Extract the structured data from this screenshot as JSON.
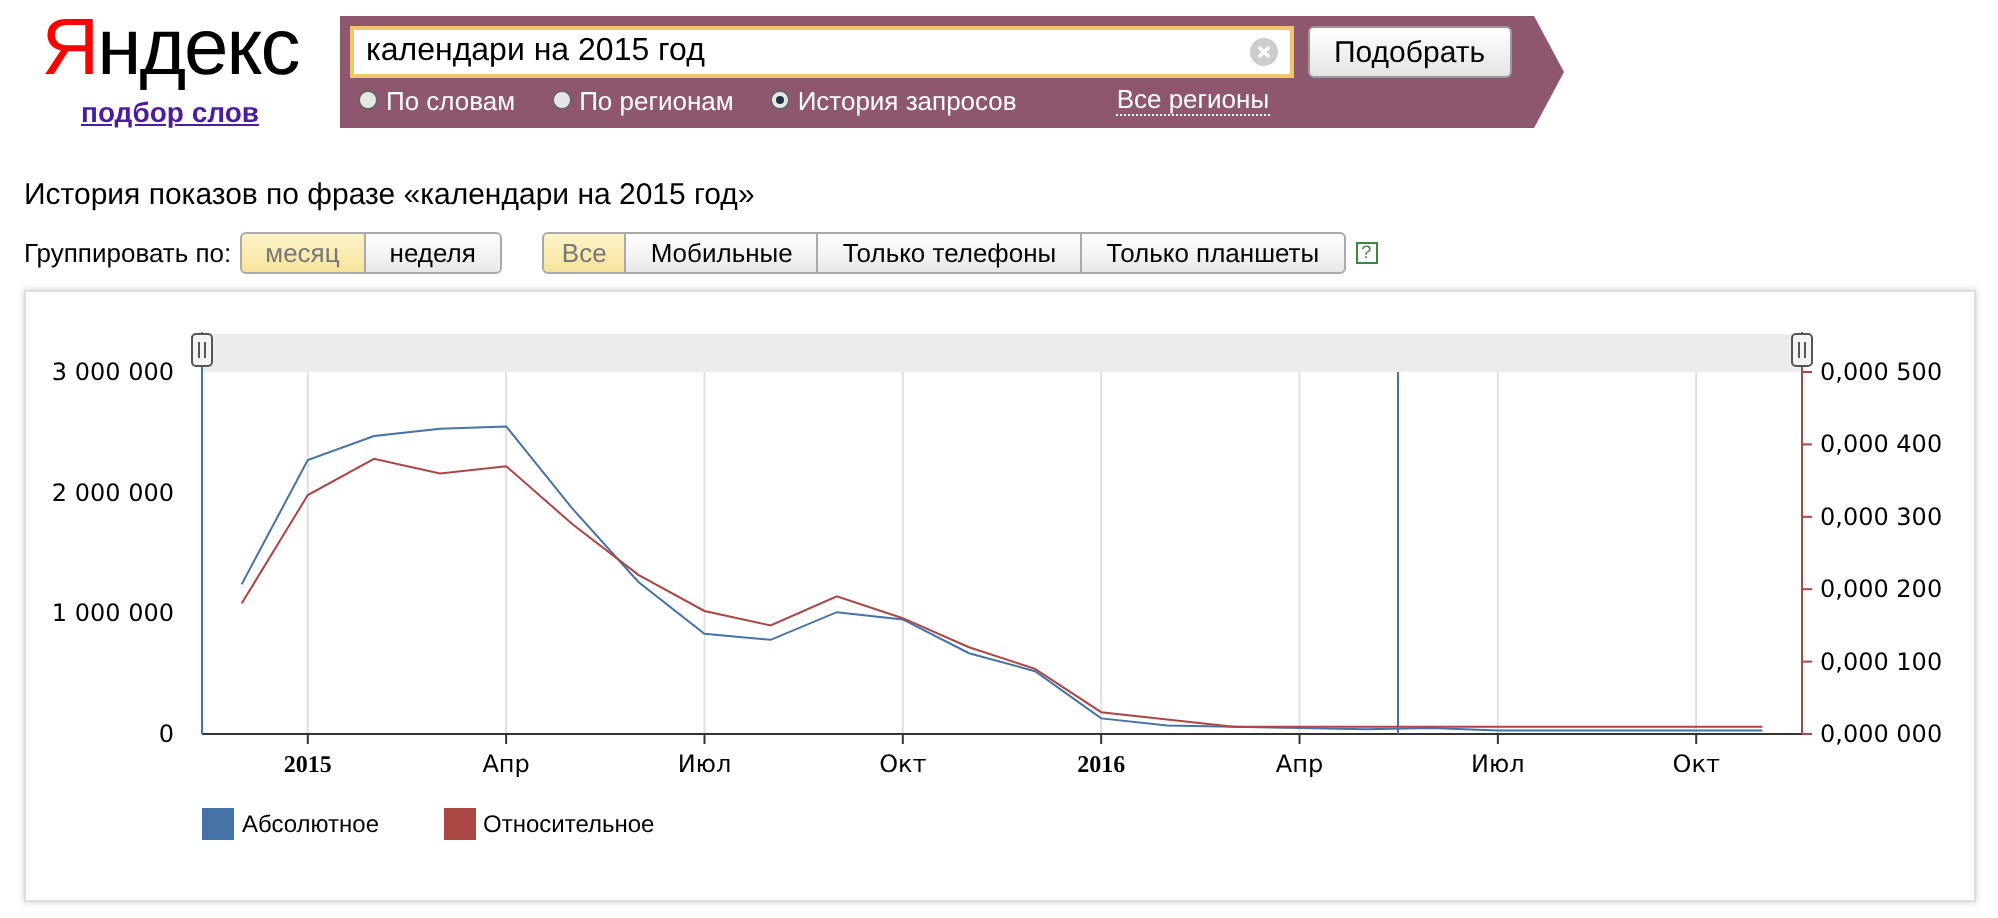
{
  "logo": {
    "text": "Яндекс",
    "link": "подбор слов"
  },
  "search": {
    "value": "календари на 2015 год",
    "button": "Подобрать",
    "region_link": "Все регионы",
    "modes": [
      {
        "label": "По словам",
        "selected": false
      },
      {
        "label": "По регионам",
        "selected": false
      },
      {
        "label": "История запросов",
        "selected": true
      }
    ]
  },
  "page_title": "История показов по фразе «календари на 2015 год»",
  "grouping": {
    "label": "Группировать по:",
    "options": [
      {
        "label": "месяц",
        "selected": true
      },
      {
        "label": "неделя",
        "selected": false
      }
    ]
  },
  "devices": [
    {
      "label": "Все",
      "selected": true
    },
    {
      "label": "Мобильные",
      "selected": false
    },
    {
      "label": "Только телефоны",
      "selected": false
    },
    {
      "label": "Только планшеты",
      "selected": false
    }
  ],
  "help": "?",
  "chart": {
    "chart_data": {
      "type": "line",
      "categories": [
        null,
        "2015",
        null,
        null,
        "Апр",
        null,
        null,
        "Июл",
        null,
        null,
        "Окт",
        null,
        null,
        "2016",
        null,
        null,
        "Апр",
        null,
        null,
        "Июл",
        null,
        null,
        "Окт",
        null
      ],
      "ylim": [
        0,
        3000000
      ],
      "grid": true,
      "yticks": [
        {
          "value": 0,
          "label": "0"
        },
        {
          "value": 1000000,
          "label": "1 000 000"
        },
        {
          "value": 2000000,
          "label": "2 000 000"
        },
        {
          "value": 3000000,
          "label": "3 000 000"
        }
      ],
      "y2lim": [
        0,
        0.0005
      ],
      "y2ticks": [
        {
          "value": 0,
          "label": "0,000 000"
        },
        {
          "value": 0.0001,
          "label": "0,000 100"
        },
        {
          "value": 0.0002,
          "label": "0,000 200"
        },
        {
          "value": 0.0003,
          "label": "0,000 300"
        },
        {
          "value": 0.0004,
          "label": "0,000 400"
        },
        {
          "value": 0.0005,
          "label": "0,000 500"
        }
      ],
      "series": [
        {
          "name": "Абсолютное",
          "color": "#4572a7",
          "values": [
            1240000,
            2270000,
            2470000,
            2530000,
            2550000,
            1870000,
            1260000,
            830000,
            780000,
            1010000,
            950000,
            670000,
            520000,
            130000,
            70000,
            60000,
            50000,
            40000,
            50000,
            30000,
            30000,
            30000,
            30000,
            30000
          ]
        },
        {
          "name": "Относительное",
          "color": "#aa4643",
          "axis": "y2",
          "values": [
            0.00018,
            0.00033,
            0.00038,
            0.00036,
            0.00037,
            0.00029,
            0.00022,
            0.00017,
            0.00015,
            0.00019,
            0.00016,
            0.00012,
            9e-05,
            3e-05,
            2e-05,
            1e-05,
            1e-05,
            1e-05,
            1e-05,
            1e-05,
            1e-05,
            1e-05,
            1e-05,
            1e-05
          ]
        }
      ]
    }
  }
}
